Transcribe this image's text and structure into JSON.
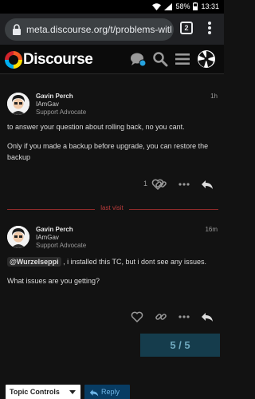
{
  "status_bar": {
    "battery": "58%",
    "time": "13:31",
    "icons": [
      "wifi-icon",
      "signal-icon",
      "battery-icon"
    ]
  },
  "browser": {
    "url": "meta.discourse.org/t/problems-with-",
    "tab_count": "2",
    "icons": [
      "lock-icon",
      "tabs-icon",
      "menu-dots-icon"
    ]
  },
  "header": {
    "logo_text": "Discourse",
    "icons": [
      "chat-icon",
      "search-icon",
      "hamburger-icon",
      "user-avatar"
    ]
  },
  "posts": [
    {
      "username": "Gavin Perch",
      "handle": "IAmGav",
      "role": "Support Advocate",
      "time": "1h",
      "paragraphs": [
        "to answer your question about rolling back, no you cant.",
        "Only if you made a backup before upgrade, you can restore the backup"
      ],
      "like_count": "1"
    },
    {
      "username": "Gavin Perch",
      "handle": "IAmGav",
      "role": "Support Advocate",
      "time": "16m",
      "mention": "@Wurzelseppi",
      "paragraph1_rest": " , i installed this TC, but i dont see any issues.",
      "paragraph2": "What issues are you getting?"
    }
  ],
  "last_visit_label": "last visit",
  "progress": "5 / 5",
  "bottom": {
    "topic_controls": "Topic Controls",
    "reply": "Reply"
  },
  "colors": {
    "background": "#121212",
    "last_visit": "#b93b3b",
    "progress_bg": "#153c4c",
    "reply_bg": "#083c63"
  }
}
